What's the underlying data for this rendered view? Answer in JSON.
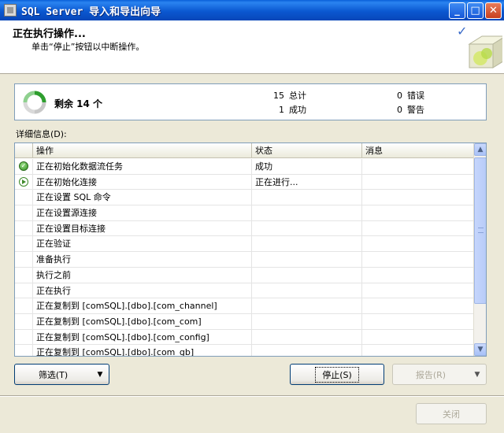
{
  "window": {
    "title": "SQL Server 导入和导出向导",
    "minimize_label": "_",
    "maximize_label": "□",
    "close_label": "✕"
  },
  "header": {
    "title": "正在执行操作...",
    "subtitle": "单击“停止”按钮以中断操作。"
  },
  "summary": {
    "remaining": "剩余 14 个",
    "total_num": "15",
    "total_label": "总计",
    "success_num": "1",
    "success_label": "成功",
    "error_num": "0",
    "error_label": "错误",
    "warning_num": "0",
    "warning_label": "警告"
  },
  "details_label": "详细信息(D):",
  "table": {
    "columns": [
      "",
      "操作",
      "状态",
      "消息"
    ],
    "rows": [
      {
        "icon": "success-icon",
        "operation": "正在初始化数据流任务",
        "status": "成功",
        "message": ""
      },
      {
        "icon": "running-icon",
        "operation": "正在初始化连接",
        "status": "正在进行...",
        "message": ""
      },
      {
        "icon": "",
        "operation": "正在设置 SQL 命令",
        "status": "",
        "message": ""
      },
      {
        "icon": "",
        "operation": "正在设置源连接",
        "status": "",
        "message": ""
      },
      {
        "icon": "",
        "operation": "正在设置目标连接",
        "status": "",
        "message": ""
      },
      {
        "icon": "",
        "operation": "正在验证",
        "status": "",
        "message": ""
      },
      {
        "icon": "",
        "operation": "准备执行",
        "status": "",
        "message": ""
      },
      {
        "icon": "",
        "operation": "执行之前",
        "status": "",
        "message": ""
      },
      {
        "icon": "",
        "operation": "正在执行",
        "status": "",
        "message": ""
      },
      {
        "icon": "",
        "operation": "正在复制到 [comSQL].[dbo].[com_channel]",
        "status": "",
        "message": ""
      },
      {
        "icon": "",
        "operation": "正在复制到 [comSQL].[dbo].[com_com]",
        "status": "",
        "message": ""
      },
      {
        "icon": "",
        "operation": "正在复制到 [comSQL].[dbo].[com_config]",
        "status": "",
        "message": ""
      },
      {
        "icon": "",
        "operation": "正在复制到 [comSQL].[dbo].[com_gb]",
        "status": "",
        "message": ""
      }
    ]
  },
  "buttons": {
    "filter": "筛选(T)",
    "stop": "停止(S)",
    "report": "报告(R)",
    "close": "关闭"
  },
  "colors": {
    "titlebar": "#0b58d1",
    "dialog_bg": "#ece9d8",
    "border": "#7f9db9"
  }
}
